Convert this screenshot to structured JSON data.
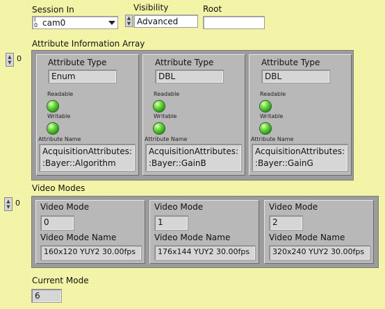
{
  "session": {
    "label": "Session In",
    "io_glyph_top": "I",
    "io_glyph_bottom": "0",
    "value": "cam0"
  },
  "visibility": {
    "label": "Visibility",
    "value": "Advanced"
  },
  "root": {
    "label": "Root",
    "value": ""
  },
  "attribute_array": {
    "label": "Attribute Information Array",
    "index": "0",
    "items": [
      {
        "type_label": "Attribute Type",
        "type_value": "Enum",
        "readable_label": "Readable",
        "readable": true,
        "writable_label": "Writable",
        "writable": true,
        "name_label": "Attribute Name",
        "name_line1": "AcquisitionAttributes:",
        "name_line2": ":Bayer::Algorithm"
      },
      {
        "type_label": "Attribute Type",
        "type_value": "DBL",
        "readable_label": "Readable",
        "readable": true,
        "writable_label": "Writable",
        "writable": true,
        "name_label": "Attribute Name",
        "name_line1": "AcquisitionAttributes:",
        "name_line2": ":Bayer::GainB"
      },
      {
        "type_label": "Attribute Type",
        "type_value": "DBL",
        "readable_label": "Readable",
        "readable": true,
        "writable_label": "Writable",
        "writable": true,
        "name_label": "Attribute Name",
        "name_line1": "AcquisitionAttributes:",
        "name_line2": ":Bayer::GainG"
      }
    ]
  },
  "video_modes": {
    "label": "Video Modes",
    "index": "0",
    "items": [
      {
        "mode_label": "Video Mode",
        "mode_value": "0",
        "name_label": "Video Mode Name",
        "name_value": "160x120 YUY2 30.00fps"
      },
      {
        "mode_label": "Video Mode",
        "mode_value": "1",
        "name_label": "Video Mode Name",
        "name_value": "176x144 YUY2 30.00fps"
      },
      {
        "mode_label": "Video Mode",
        "mode_value": "2",
        "name_label": "Video Mode Name",
        "name_value": "320x240 YUY2 30.00fps"
      }
    ]
  },
  "current_mode": {
    "label": "Current Mode",
    "value": "6"
  },
  "colors": {
    "panel_bg": "#f4f5a8",
    "cluster_bg": "#b8b8b8",
    "led_on": "#3fd020"
  }
}
